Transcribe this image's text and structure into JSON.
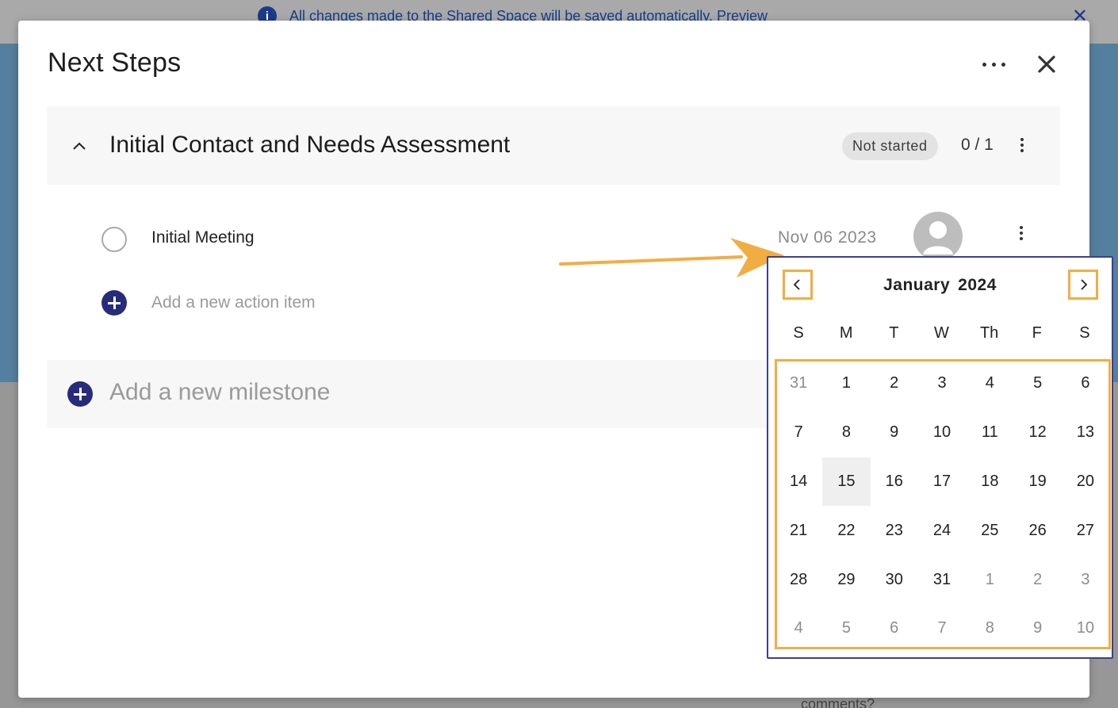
{
  "background": {
    "banner_text": "All changes made to the Shared Space will be saved automatically.  Preview",
    "info_icon": "info-icon",
    "bottom_text": "comments?"
  },
  "modal": {
    "title": "Next Steps",
    "more_icon": "more-horizontal-icon",
    "close_icon": "close-icon"
  },
  "milestone": {
    "title": "Initial Contact and Needs Assessment",
    "status": "Not started",
    "progress": "0 / 1",
    "collapse_icon": "chevron-up-icon",
    "menu_icon": "more-vertical-icon"
  },
  "action_item": {
    "label": "Initial Meeting",
    "due_date": "Nov 06 2023",
    "assignee_icon": "avatar-icon",
    "menu_icon": "more-vertical-icon"
  },
  "add_action": {
    "label": "Add a new action item",
    "icon": "plus-circle-icon"
  },
  "add_milestone": {
    "label": "Add a new milestone",
    "icon": "plus-circle-icon"
  },
  "annotation": {
    "arrow_color": "#f2ad42",
    "highlight_color": "#f2ad42"
  },
  "calendar": {
    "month": "January",
    "year": "2024",
    "prev_icon": "chevron-left-icon",
    "next_icon": "chevron-right-icon",
    "weekdays": [
      "S",
      "M",
      "T",
      "W",
      "Th",
      "F",
      "S"
    ],
    "highlighted_day": "15",
    "weeks": [
      [
        {
          "d": "31",
          "muted": true
        },
        {
          "d": "1"
        },
        {
          "d": "2"
        },
        {
          "d": "3"
        },
        {
          "d": "4"
        },
        {
          "d": "5"
        },
        {
          "d": "6"
        }
      ],
      [
        {
          "d": "7"
        },
        {
          "d": "8"
        },
        {
          "d": "9"
        },
        {
          "d": "10"
        },
        {
          "d": "11"
        },
        {
          "d": "12"
        },
        {
          "d": "13"
        }
      ],
      [
        {
          "d": "14"
        },
        {
          "d": "15",
          "today": true
        },
        {
          "d": "16"
        },
        {
          "d": "17"
        },
        {
          "d": "18"
        },
        {
          "d": "19"
        },
        {
          "d": "20"
        }
      ],
      [
        {
          "d": "21"
        },
        {
          "d": "22"
        },
        {
          "d": "23"
        },
        {
          "d": "24"
        },
        {
          "d": "25"
        },
        {
          "d": "26"
        },
        {
          "d": "27"
        }
      ],
      [
        {
          "d": "28"
        },
        {
          "d": "29"
        },
        {
          "d": "30"
        },
        {
          "d": "31"
        },
        {
          "d": "1",
          "muted": true
        },
        {
          "d": "2",
          "muted": true
        },
        {
          "d": "3",
          "muted": true
        }
      ],
      [
        {
          "d": "4",
          "muted": true
        },
        {
          "d": "5",
          "muted": true
        },
        {
          "d": "6",
          "muted": true
        },
        {
          "d": "7",
          "muted": true
        },
        {
          "d": "8",
          "muted": true
        },
        {
          "d": "9",
          "muted": true
        },
        {
          "d": "10",
          "muted": true
        }
      ]
    ]
  },
  "colors": {
    "accent": "#262b7c",
    "calendar_border": "#3a3f95",
    "muted_text": "#8d8d8d"
  }
}
